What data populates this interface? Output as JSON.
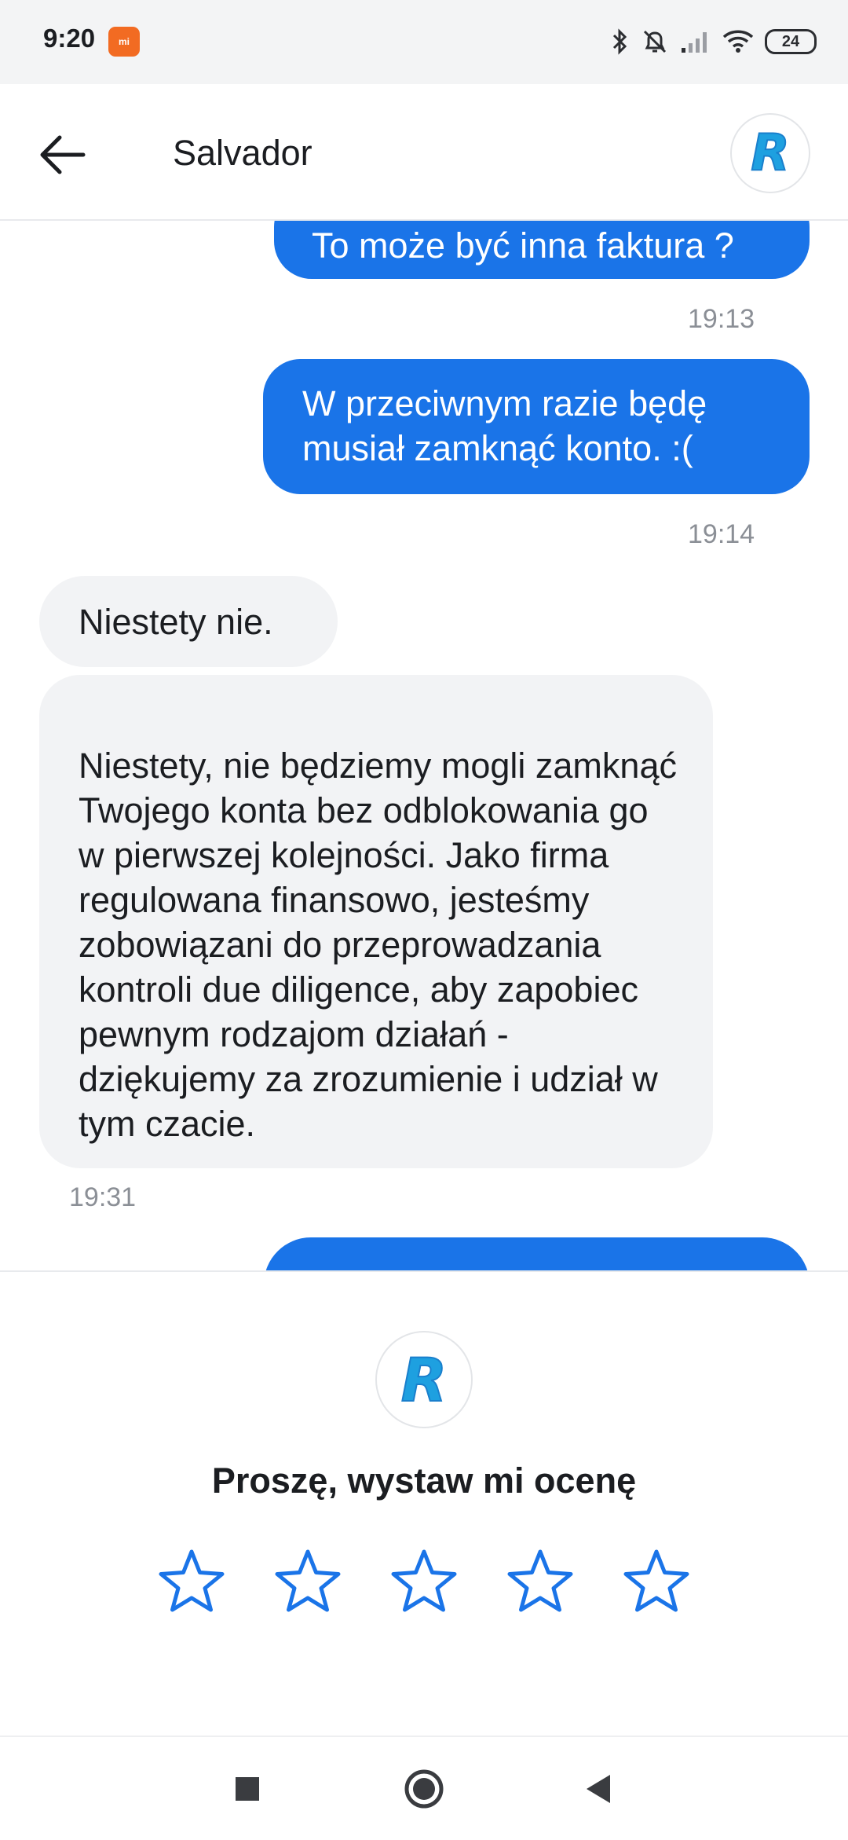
{
  "status_bar": {
    "time": "9:20",
    "mi_badge": "mi",
    "battery": "24",
    "icons": [
      "bluetooth-icon",
      "bell-off-icon",
      "signal-icon",
      "wifi-icon",
      "battery-icon"
    ]
  },
  "header": {
    "title": "Salvador",
    "logo_letter": "R"
  },
  "messages": [
    {
      "direction": "out",
      "text": "To może być inna faktura ?",
      "time": "19:13"
    },
    {
      "direction": "out",
      "text": "W przeciwnym razie będę musiał zamknąć konto. :(",
      "time": "19:14"
    },
    {
      "direction": "in",
      "text": "Niestety nie."
    },
    {
      "direction": "in",
      "text": "Niestety, nie będziemy mogli zamknąć Twojego konta bez odblokowania go w pierwszej kolejności. Jako firma regulowana finansowo, jesteśmy zobowiązani do przeprowadzania kontroli due diligence, aby zapobiec pewnym rodzajom działań - dziękujemy za zrozumienie i udział w tym czacie.",
      "time": "19:31"
    }
  ],
  "rating": {
    "logo_letter": "R",
    "title": "Proszę, wystaw mi ocenę",
    "max_stars": 5,
    "selected": 0
  },
  "colors": {
    "accent": "#1a74e8",
    "incoming_bubble": "#f2f3f5",
    "timestamp": "#8b8f96",
    "logo": "#1ea0e0"
  }
}
